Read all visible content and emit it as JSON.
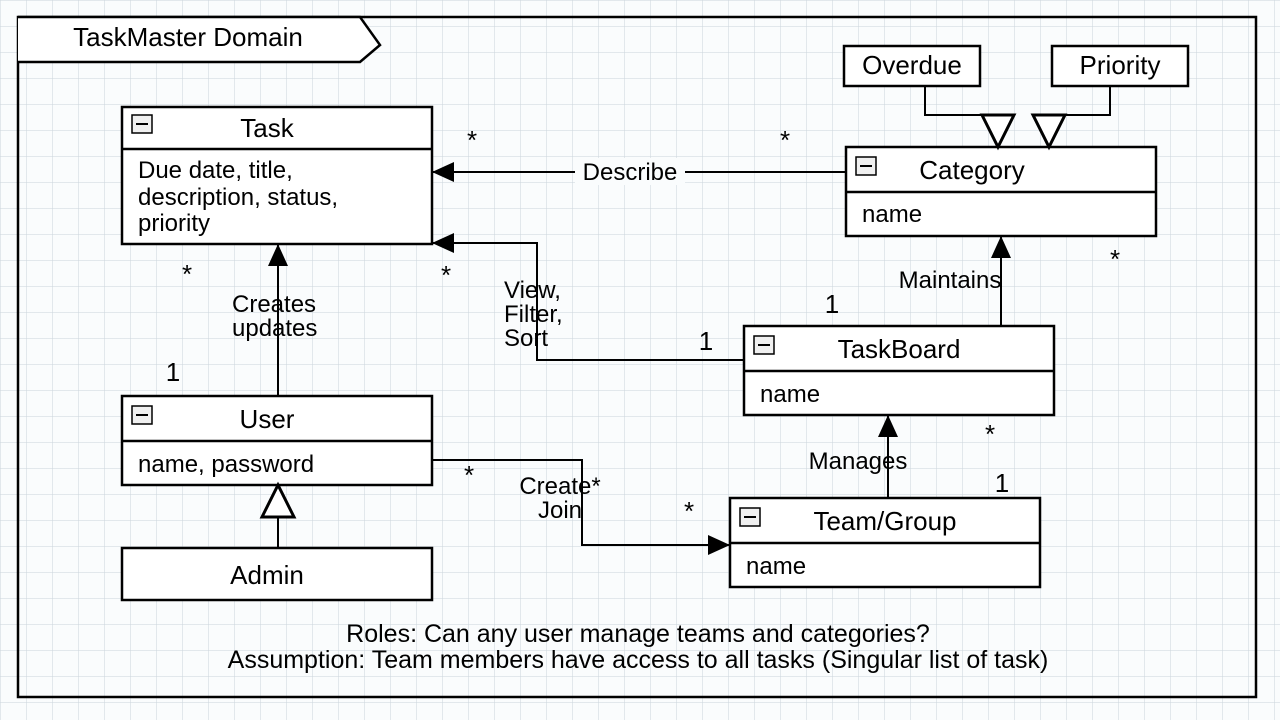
{
  "domain_title": "TaskMaster Domain",
  "entities": {
    "task": {
      "title": "Task",
      "attrs": "Due date, title, description, status, priority"
    },
    "user": {
      "title": "User",
      "attrs": "name, password"
    },
    "admin": {
      "title": "Admin"
    },
    "category": {
      "title": "Category",
      "attrs": "name"
    },
    "taskboard": {
      "title": "TaskBoard",
      "attrs": "name"
    },
    "team": {
      "title": "Team/Group",
      "attrs": "name"
    },
    "overdue": {
      "title": "Overdue"
    },
    "priority": {
      "title": "Priority"
    }
  },
  "relationships": {
    "describe": {
      "label": "Describe",
      "mult_left": "*",
      "mult_right": "*"
    },
    "creates_updates": {
      "label1": "Creates",
      "label2": "updates",
      "mult_task": "*",
      "mult_user": "1"
    },
    "view_filter_sort": {
      "label1": "View,",
      "label2": "Filter,",
      "label3": "Sort",
      "mult_task": "*",
      "mult_board": "1"
    },
    "maintains": {
      "label": "Maintains",
      "mult_board": "1",
      "mult_cat": "*"
    },
    "manages": {
      "label": "Manages",
      "mult_board": "*",
      "mult_team": "1"
    },
    "create_join": {
      "label1": "Create*",
      "label2": "Join",
      "mult_user": "*",
      "mult_team": "*"
    }
  },
  "notes": {
    "line1": "Roles: Can any user manage teams and categories?",
    "line2": "Assumption: Team members have access to all tasks (Singular list of task)"
  }
}
